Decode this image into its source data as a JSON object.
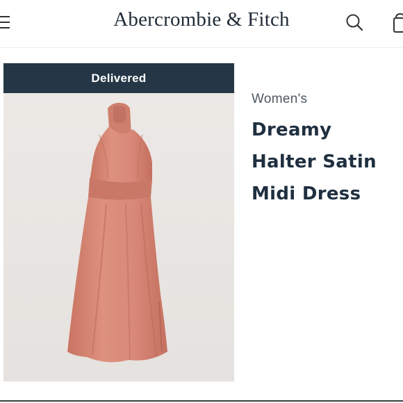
{
  "header": {
    "brand": "Abercrombie & Fitch",
    "menu_icon": "hamburger-menu-icon",
    "search_icon": "search-icon",
    "bag_icon": "shopping-bag-icon"
  },
  "product": {
    "status_banner": "Delivered",
    "gender": "Women's",
    "title_lines": [
      "Dreamy",
      "Halter Satin",
      "Midi Dress"
    ],
    "dress_color": "#d98a78"
  },
  "colors": {
    "banner_bg": "#253746",
    "brand_text": "#1f2a36",
    "title_text": "#1f2f3f"
  }
}
